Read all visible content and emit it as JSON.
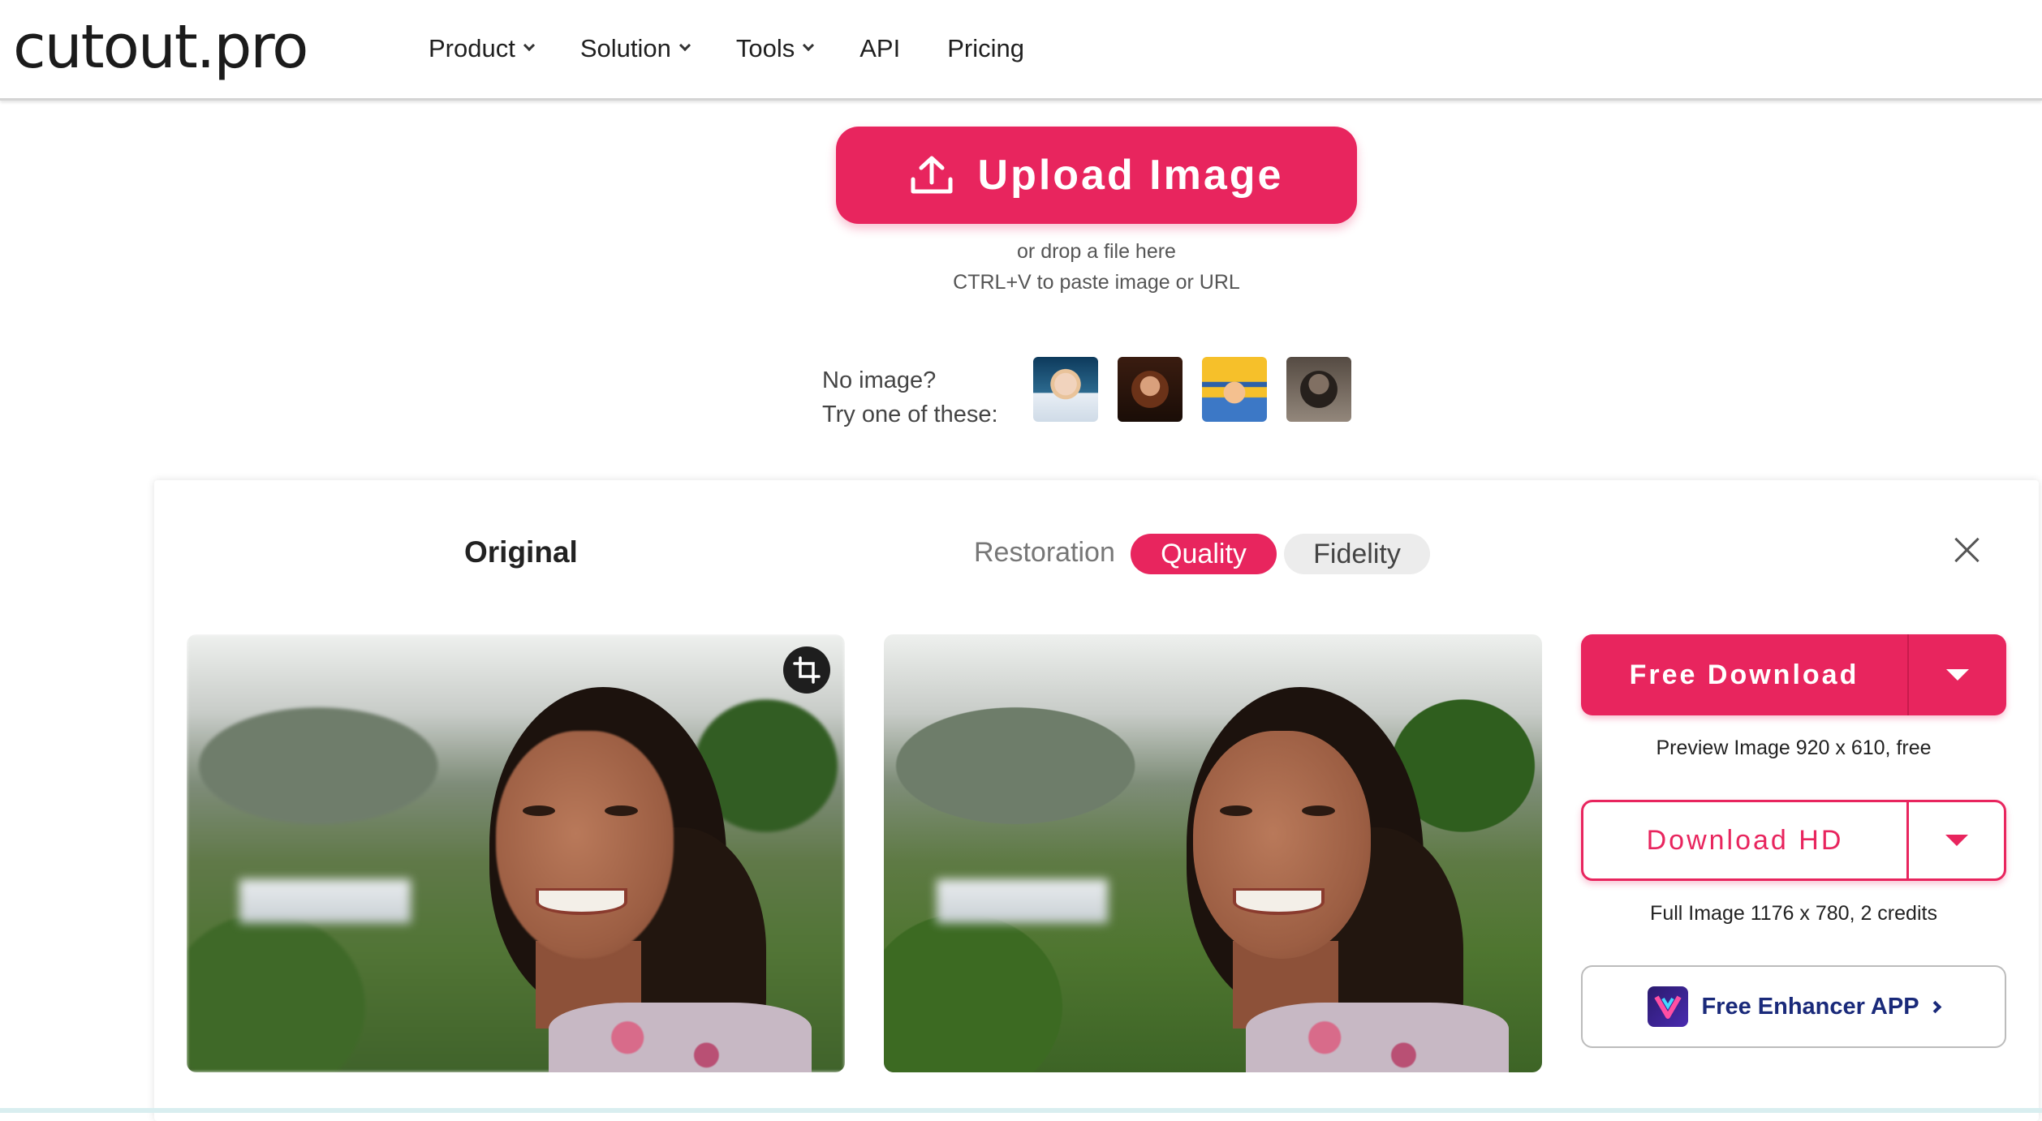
{
  "header": {
    "logo": "cutout.pro",
    "nav": [
      {
        "label": "Product"
      },
      {
        "label": "Solution"
      },
      {
        "label": "Tools"
      },
      {
        "label": "API"
      },
      {
        "label": "Pricing"
      }
    ]
  },
  "upload": {
    "button_label": "Upload Image",
    "drop_hint": "or drop a file here",
    "paste_hint": "CTRL+V to paste image or URL",
    "samples_line1": "No image?",
    "samples_line2": "Try one of these:"
  },
  "panel": {
    "original_title": "Original",
    "restoration_label": "Restoration",
    "tabs": [
      {
        "label": "Quality",
        "active": true
      },
      {
        "label": "Fidelity",
        "active": false
      }
    ]
  },
  "downloads": {
    "free_label": "Free Download",
    "free_caption": "Preview Image 920 x 610, free",
    "hd_label": "Download HD",
    "hd_caption": "Full Image 1176 x 780, 2 credits",
    "app_label": "Free Enhancer APP"
  },
  "colors": {
    "accent": "#e8255e",
    "app_text": "#1a2a7a"
  },
  "icons": [
    "upload-icon",
    "chevron-down-icon",
    "close-icon",
    "crop-icon",
    "caret-down-icon",
    "enhancer-app-icon",
    "chevron-right-icon"
  ]
}
